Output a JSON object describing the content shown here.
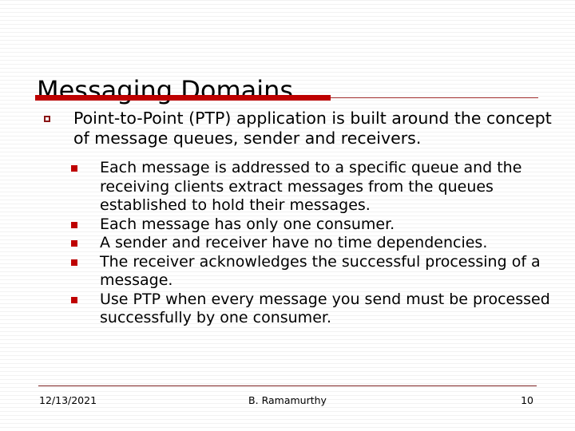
{
  "slide": {
    "title": "Messaging Domains",
    "accent_color": "#c00000",
    "rule_color": "#8c1616"
  },
  "content": {
    "bullets": [
      {
        "level": 1,
        "marker": "hollow-square-bullet",
        "text": "Point-to-Point (PTP) application is built around the concept of message queues, sender and receivers."
      },
      {
        "level": 2,
        "marker": "filled-square-bullet",
        "text": "Each message is addressed to a specific queue and the receiving clients extract messages from the queues established to hold their messages."
      },
      {
        "level": 2,
        "marker": "filled-square-bullet",
        "text": "Each message has only one consumer."
      },
      {
        "level": 2,
        "marker": "filled-square-bullet",
        "text": "A sender and receiver have no time dependencies."
      },
      {
        "level": 2,
        "marker": "filled-square-bullet",
        "text": "The receiver acknowledges the successful processing of a message."
      },
      {
        "level": 2,
        "marker": "filled-square-bullet",
        "text": "Use PTP when every message you send must be processed successfully by one consumer."
      }
    ]
  },
  "footer": {
    "date": "12/13/2021",
    "author": "B. Ramamurthy",
    "page_number": "10"
  }
}
